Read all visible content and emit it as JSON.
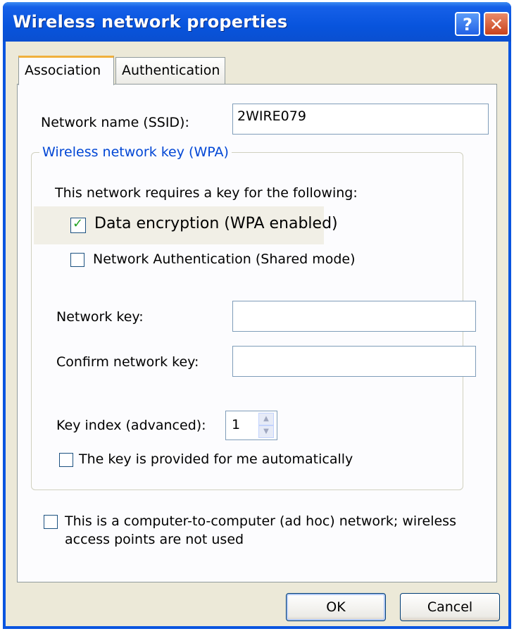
{
  "window": {
    "title": "Wireless network properties",
    "help_label": "?",
    "close_label": "✕"
  },
  "tabs": [
    {
      "label": "Association"
    },
    {
      "label": "Authentication"
    }
  ],
  "association": {
    "ssid_label": "Network name (SSID):",
    "ssid_value": "2WIRE079",
    "group_title": "Wireless network key (WPA)",
    "requires_text": "This network requires a key for the following:",
    "data_encryption_label": "Data encryption (WPA enabled)",
    "data_encryption_checked": true,
    "network_auth_label": "Network Authentication (Shared mode)",
    "network_auth_checked": false,
    "network_key_label": "Network key:",
    "network_key_value": "",
    "confirm_key_label": "Confirm network key:",
    "confirm_key_value": "",
    "key_index_label": "Key index (advanced):",
    "key_index_value": "1",
    "auto_key_label": "The key is provided for me automatically",
    "auto_key_checked": false,
    "adhoc_label_line1": "This is a computer-to-computer (ad hoc) network; wireless",
    "adhoc_label_line2": "access points are not used",
    "adhoc_checked": false
  },
  "buttons": {
    "ok": "OK",
    "cancel": "Cancel"
  }
}
